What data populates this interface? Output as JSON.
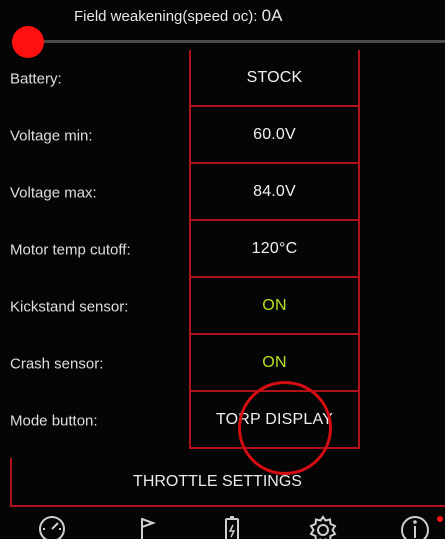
{
  "slider": {
    "label": "Field weakening(speed oc):",
    "value": "0A",
    "level": 0
  },
  "settings": [
    {
      "label": "Battery:",
      "value": "STOCK",
      "status": "normal"
    },
    {
      "label": "Voltage min:",
      "value": "60.0V",
      "status": "normal"
    },
    {
      "label": "Voltage max:",
      "value": "84.0V",
      "status": "normal"
    },
    {
      "label": "Motor temp cutoff:",
      "value": "120°C",
      "status": "normal"
    },
    {
      "label": "Kickstand sensor:",
      "value": "ON",
      "status": "on"
    },
    {
      "label": "Crash sensor:",
      "value": "ON",
      "status": "on"
    },
    {
      "label": "Mode button:",
      "value": "TORP DISPLAY",
      "status": "normal"
    }
  ],
  "throttle_button": {
    "label": "THROTTLE SETTINGS"
  },
  "tabs": [
    {
      "icon": "speedometer-icon"
    },
    {
      "icon": "flag-icon"
    },
    {
      "icon": "battery-icon"
    },
    {
      "icon": "gear-icon"
    },
    {
      "icon": "info-icon"
    }
  ],
  "colors": {
    "accent_red": "#b3111a",
    "on_green": "#b7e21d",
    "background": "#050505"
  }
}
